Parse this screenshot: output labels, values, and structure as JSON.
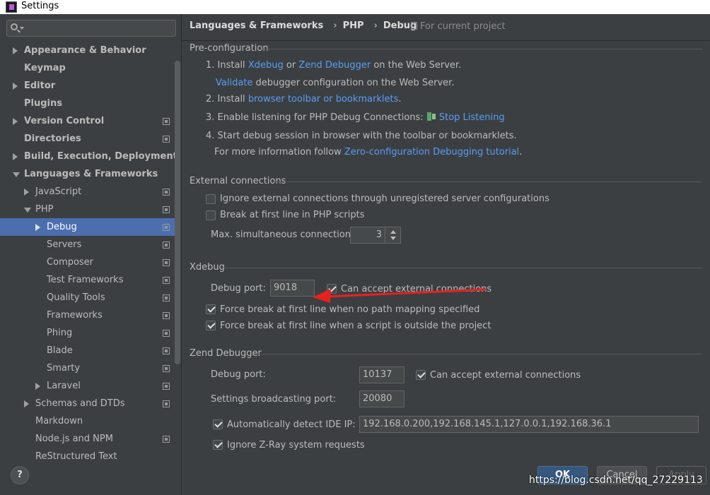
{
  "window": {
    "title": "Settings"
  },
  "search": {
    "placeholder": ""
  },
  "tree": [
    {
      "label": "Appearance & Behavior",
      "level": 0,
      "arrow": "right",
      "bold": true,
      "proj": false
    },
    {
      "label": "Keymap",
      "level": 0,
      "arrow": "",
      "bold": true,
      "proj": false
    },
    {
      "label": "Editor",
      "level": 0,
      "arrow": "right",
      "bold": true,
      "proj": false
    },
    {
      "label": "Plugins",
      "level": 0,
      "arrow": "",
      "bold": true,
      "proj": false
    },
    {
      "label": "Version Control",
      "level": 0,
      "arrow": "right",
      "bold": true,
      "proj": true
    },
    {
      "label": "Directories",
      "level": 0,
      "arrow": "",
      "bold": true,
      "proj": true
    },
    {
      "label": "Build, Execution, Deployment",
      "level": 0,
      "arrow": "right",
      "bold": true,
      "proj": false
    },
    {
      "label": "Languages & Frameworks",
      "level": 0,
      "arrow": "down",
      "bold": true,
      "proj": false
    },
    {
      "label": "JavaScript",
      "level": 1,
      "arrow": "right",
      "bold": false,
      "proj": true
    },
    {
      "label": "PHP",
      "level": 1,
      "arrow": "down",
      "bold": false,
      "proj": true
    },
    {
      "label": "Debug",
      "level": 2,
      "arrow": "right",
      "bold": false,
      "proj": true,
      "selected": true
    },
    {
      "label": "Servers",
      "level": 2,
      "arrow": "",
      "bold": false,
      "proj": true
    },
    {
      "label": "Composer",
      "level": 2,
      "arrow": "",
      "bold": false,
      "proj": true
    },
    {
      "label": "Test Frameworks",
      "level": 2,
      "arrow": "",
      "bold": false,
      "proj": true
    },
    {
      "label": "Quality Tools",
      "level": 2,
      "arrow": "",
      "bold": false,
      "proj": true
    },
    {
      "label": "Frameworks",
      "level": 2,
      "arrow": "",
      "bold": false,
      "proj": true
    },
    {
      "label": "Phing",
      "level": 2,
      "arrow": "",
      "bold": false,
      "proj": true
    },
    {
      "label": "Blade",
      "level": 2,
      "arrow": "",
      "bold": false,
      "proj": true
    },
    {
      "label": "Smarty",
      "level": 2,
      "arrow": "",
      "bold": false,
      "proj": true
    },
    {
      "label": "Laravel",
      "level": 2,
      "arrow": "right",
      "bold": false,
      "proj": true
    },
    {
      "label": "Schemas and DTDs",
      "level": 1,
      "arrow": "right",
      "bold": false,
      "proj": true
    },
    {
      "label": "Markdown",
      "level": 1,
      "arrow": "",
      "bold": false,
      "proj": false
    },
    {
      "label": "Node.js and NPM",
      "level": 1,
      "arrow": "",
      "bold": false,
      "proj": true
    },
    {
      "label": "ReStructured Text",
      "level": 1,
      "arrow": "",
      "bold": false,
      "proj": false
    }
  ],
  "help": {
    "label": "?"
  },
  "breadcrumb": {
    "part1": "Languages & Frameworks",
    "sep": "›",
    "part2": "PHP",
    "part3": "Debug",
    "for_project": "For current project"
  },
  "pre": {
    "title": "Pre-configuration",
    "s1_a": "1. Install",
    "s1_xdebug": "Xdebug",
    "s1_or": "or",
    "s1_zend": "Zend Debugger",
    "s1_b": "on the Web Server.",
    "validate": "Validate",
    "validate_rest": "debugger configuration on the Web Server.",
    "s2_a": "2. Install",
    "s2_link": "browser toolbar or bookmarklets",
    "s2_dot": ".",
    "s3_a": "3. Enable listening for PHP Debug Connections:",
    "s3_link": "Stop Listening",
    "s4": "4. Start debug session in browser with the toolbar or bookmarklets.",
    "more_a": "For more information follow",
    "more_link": "Zero-configuration Debugging tutorial",
    "more_dot": "."
  },
  "ext": {
    "title": "External connections",
    "ignore": "Ignore external connections through unregistered server configurations",
    "break_first": "Break at first line in PHP scripts",
    "max_label": "Max. simultaneous connections:",
    "max_value": "3"
  },
  "xdebug": {
    "title": "Xdebug",
    "port_label": "Debug port:",
    "port_value": "9018",
    "accept": "Can accept external connections",
    "force_nomap": "Force break at first line when no path mapping specified",
    "force_outside": "Force break at first line when a script is outside the project"
  },
  "zend": {
    "title": "Zend Debugger",
    "port_label": "Debug port:",
    "port_value": "10137",
    "accept": "Can accept external connections",
    "bcast_label": "Settings broadcasting port:",
    "bcast_value": "20080",
    "auto_ip": "Automatically detect IDE IP:",
    "ip_value": "192.168.0.200,192.168.145.1,127.0.0.1,192.168.36.1",
    "ignore_zray": "Ignore Z-Ray system requests"
  },
  "buttons": {
    "ok": "OK",
    "cancel": "Cancel",
    "apply": "Apply"
  },
  "watermark": "https://blog.csdn.net/qq_27229113",
  "colors": {
    "selection": "#4b6eaf",
    "link": "#589df6",
    "annotation_arrow": "#e8211f",
    "background": "#3c3f41"
  }
}
